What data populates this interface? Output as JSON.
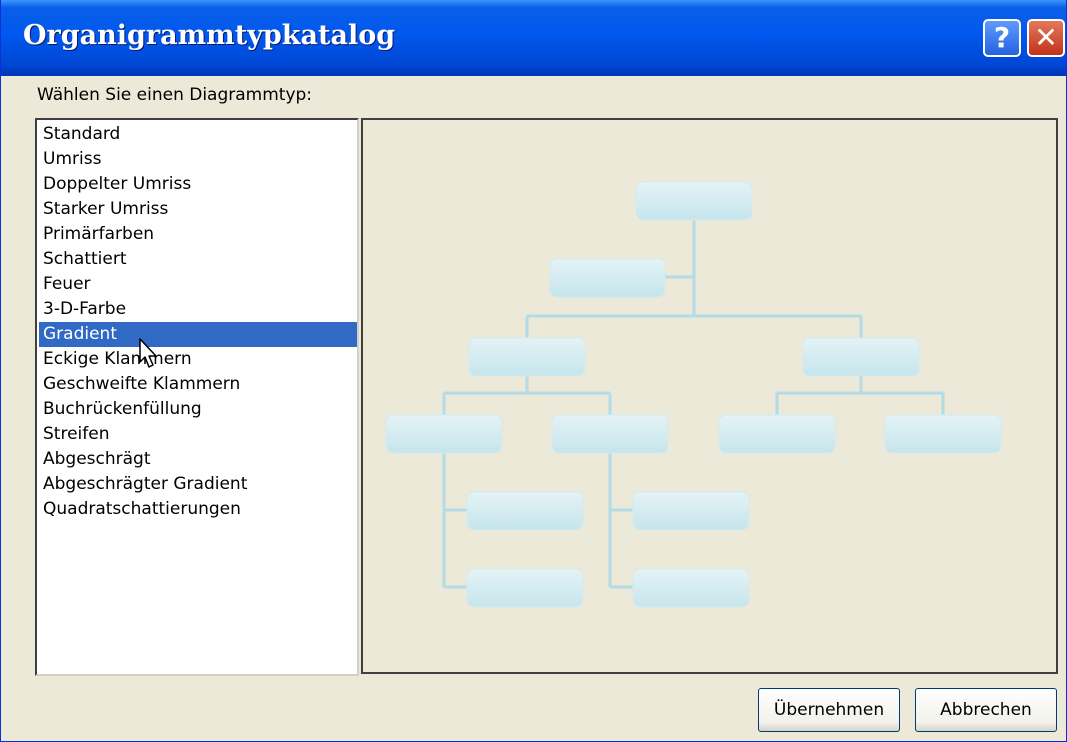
{
  "dialog": {
    "title": "Organigrammtypkatalog",
    "help_button": "?",
    "close_button": "✕"
  },
  "prompt_label": "Wählen Sie einen Diagrammtyp:",
  "diagram_types": [
    "Standard",
    "Umriss",
    "Doppelter Umriss",
    "Starker Umriss",
    "Primärfarben",
    "Schattiert",
    "Feuer",
    "3-D-Farbe",
    "Gradient",
    "Eckige Klammern",
    "Geschweifte Klammern",
    "Buchrückenfüllung",
    "Streifen",
    "Abgeschrägt",
    "Abgeschrägter Gradient",
    "Quadratschattierungen"
  ],
  "selected_type": "Gradient",
  "buttons": {
    "apply": "Übernehmen",
    "cancel": "Abbrechen"
  },
  "colors": {
    "titlebar": "#0058ee",
    "selection": "#316ac5",
    "dialog_bg": "#ece9d8",
    "org_box": "#cfe9ef",
    "org_line": "#b4dce6"
  }
}
